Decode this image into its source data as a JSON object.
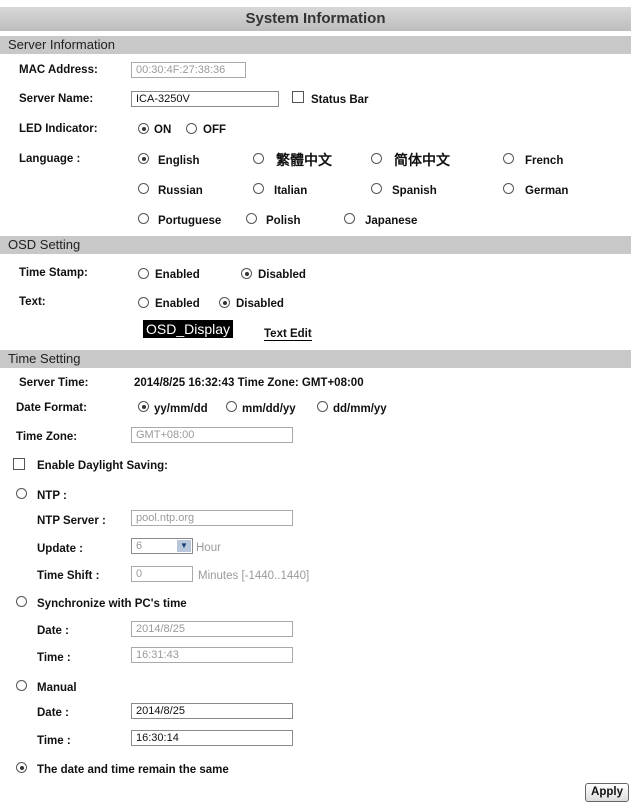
{
  "title": "System Information",
  "server": {
    "section": "Server Information",
    "mac_label": "MAC Address:",
    "mac_value": "00:30:4F:27:38:36",
    "name_label": "Server Name:",
    "name_value": "ICA-3250V",
    "status_bar_label": "Status Bar",
    "led_label": "LED Indicator:",
    "led_on": "ON",
    "led_off": "OFF",
    "lang_label": "Language :",
    "languages": [
      "English",
      "繁體中文",
      "简体中文",
      "French",
      "Russian",
      "Italian",
      "Spanish",
      "German",
      "Portuguese",
      "Polish",
      "Japanese"
    ]
  },
  "osd": {
    "section": "OSD Setting",
    "timestamp_label": "Time Stamp:",
    "enabled": "Enabled",
    "disabled": "Disabled",
    "text_label": "Text:",
    "display_text": "OSD_Display",
    "text_edit": "Text Edit"
  },
  "time": {
    "section": "Time Setting",
    "server_time_label": "Server Time:",
    "server_time_value": "2014/8/25 16:32:43 Time Zone: GMT+08:00",
    "date_format_label": "Date Format:",
    "formats": [
      "yy/mm/dd",
      "mm/dd/yy",
      "dd/mm/yy"
    ],
    "tz_label": "Time Zone:",
    "tz_value": "GMT+08:00",
    "dst_label": "Enable Daylight Saving:",
    "ntp_label": "NTP :",
    "ntp_server_label": "NTP Server :",
    "ntp_server_value": "pool.ntp.org",
    "update_label": "Update :",
    "update_value": "6",
    "update_unit": "Hour",
    "shift_label": "Time Shift :",
    "shift_value": "0",
    "shift_unit": "Minutes  [-1440..1440]",
    "sync_label": "Synchronize with PC's time",
    "date_label": "Date :",
    "time_label": "Time :",
    "pc_date": "2014/8/25",
    "pc_time": "16:31:43",
    "manual_label": "Manual",
    "manual_date": "2014/8/25",
    "manual_time": "16:30:14",
    "same_label": "The date and time remain the same"
  },
  "apply_label": "Apply"
}
